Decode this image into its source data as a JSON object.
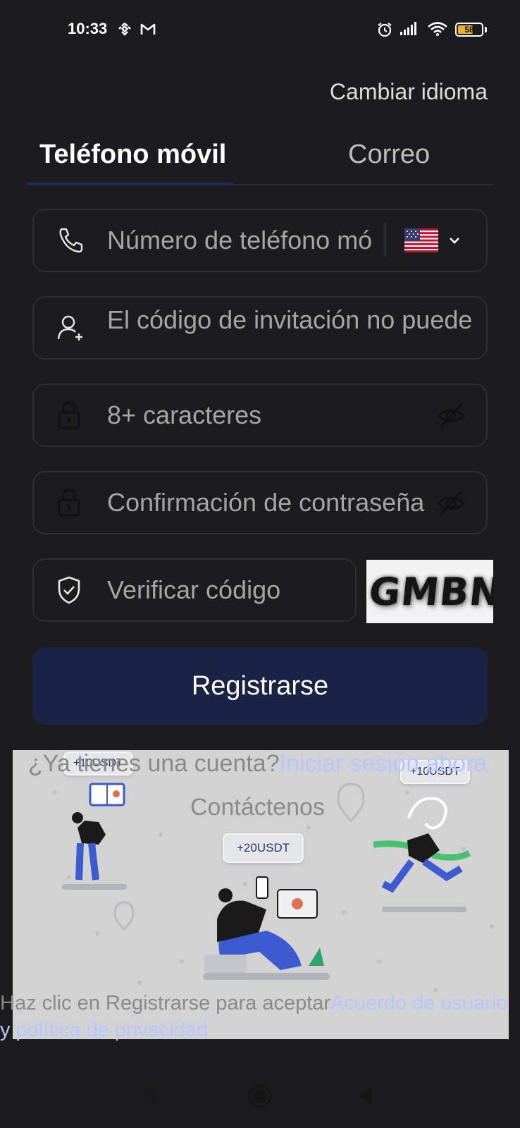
{
  "status_bar": {
    "time": "10:33",
    "battery": "58"
  },
  "header": {
    "language_link": "Cambiar idioma"
  },
  "tabs": [
    {
      "label": "Teléfono móvil",
      "active": true
    },
    {
      "label": "Correo",
      "active": false
    }
  ],
  "form": {
    "phone_placeholder": "Número de teléfono mó",
    "country": "US",
    "invite_placeholder": "El código de invitación no puede estar vacío",
    "password_placeholder": "8+ caracteres",
    "confirm_placeholder": "Confirmación de contraseña",
    "verify_placeholder": "Verificar código",
    "captcha_text": "GMBN",
    "register_button": "Registrarse"
  },
  "footer": {
    "account_question": "¿Ya tienes una cuenta?",
    "login_link": "Iniciar sesión ahora",
    "contact": "Contáctenos",
    "terms_prefix": "Haz clic en Registrarse para aceptar",
    "terms_link": "Acuerdo de usuario y política de privacidad"
  },
  "promo": {
    "badge_left": "+10USDT",
    "badge_center": "+20USDT",
    "badge_right": "+10USDT"
  },
  "colors": {
    "background": "#1c1c1e",
    "button": "#1a2345",
    "link": "#b8c6ff",
    "tab_indicator": "#1e2e5c"
  }
}
